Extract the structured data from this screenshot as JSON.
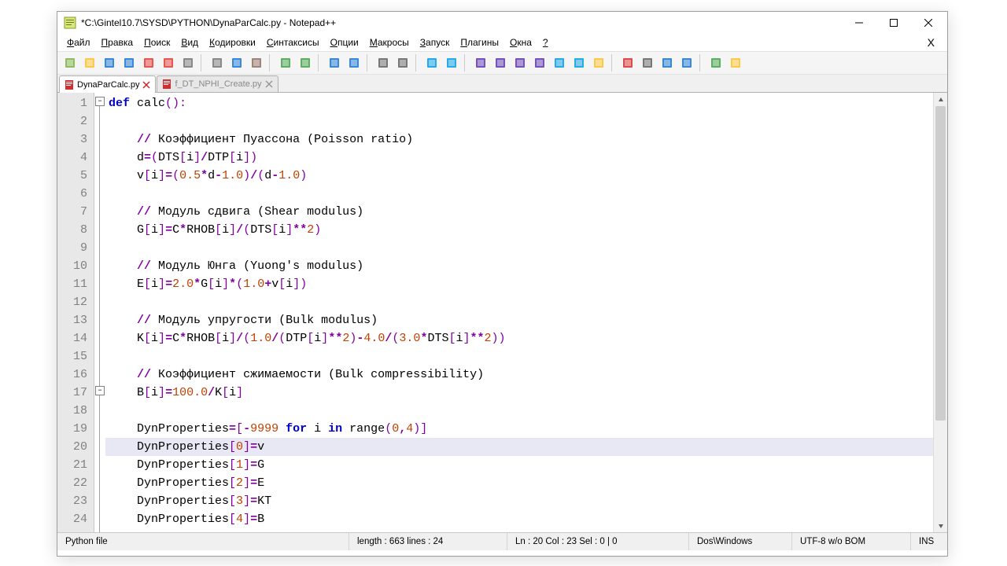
{
  "window": {
    "title": "*C:\\Gintel10.7\\SYSD\\PYTHON\\DynaParCalc.py - Notepad++"
  },
  "menu": {
    "file": "Файл",
    "edit": "Правка",
    "search": "Поиск",
    "view": "Вид",
    "encoding": "Кодировки",
    "syntax": "Синтаксисы",
    "options": "Опции",
    "macros": "Макросы",
    "run": "Запуск",
    "plugins": "Плагины",
    "windows": "Окна",
    "help": "?"
  },
  "tabs": [
    {
      "label": "DynaParCalc.py",
      "active": true,
      "dirty": true
    },
    {
      "label": "f_DT_NPHI_Create.py",
      "active": false,
      "dirty": true
    }
  ],
  "code": {
    "lines": [
      {
        "n": 1,
        "html": "<span class='kw'>def</span> <span class='fn'>calc</span><span class='br'>():</span>"
      },
      {
        "n": 2,
        "html": ""
      },
      {
        "n": 3,
        "html": "    <span class='op'>//</span> <span class='cm'>Коэффициент Пуассона (Poisson ratio)</span>"
      },
      {
        "n": 4,
        "html": "    d<span class='op'>=</span><span class='br'>(</span>DTS<span class='br'>[</span>i<span class='br'>]</span><span class='op'>/</span>DTP<span class='br'>[</span>i<span class='br'>])</span>"
      },
      {
        "n": 5,
        "html": "    v<span class='br'>[</span>i<span class='br'>]</span><span class='op'>=</span><span class='br'>(</span><span class='num'>0.5</span><span class='op'>*</span>d<span class='op'>-</span><span class='num'>1.0</span><span class='br'>)</span><span class='op'>/</span><span class='br'>(</span>d<span class='op'>-</span><span class='num'>1.0</span><span class='br'>)</span>"
      },
      {
        "n": 6,
        "html": ""
      },
      {
        "n": 7,
        "html": "    <span class='op'>//</span> <span class='cm'>Модуль сдвига (Shear modulus)</span>"
      },
      {
        "n": 8,
        "html": "    G<span class='br'>[</span>i<span class='br'>]</span><span class='op'>=</span>C<span class='op'>*</span>RHOB<span class='br'>[</span>i<span class='br'>]</span><span class='op'>/</span><span class='br'>(</span>DTS<span class='br'>[</span>i<span class='br'>]</span><span class='op'>**</span><span class='num'>2</span><span class='br'>)</span>"
      },
      {
        "n": 9,
        "html": ""
      },
      {
        "n": 10,
        "html": "    <span class='op'>//</span> <span class='cm'>Модуль Юнга (Yuong's modulus)</span>"
      },
      {
        "n": 11,
        "html": "    E<span class='br'>[</span>i<span class='br'>]</span><span class='op'>=</span><span class='num'>2.0</span><span class='op'>*</span>G<span class='br'>[</span>i<span class='br'>]</span><span class='op'>*</span><span class='br'>(</span><span class='num'>1.0</span><span class='op'>+</span>v<span class='br'>[</span>i<span class='br'>])</span>"
      },
      {
        "n": 12,
        "html": ""
      },
      {
        "n": 13,
        "html": "    <span class='op'>//</span> <span class='cm'>Модуль упругости (Bulk modulus)</span>"
      },
      {
        "n": 14,
        "html": "    K<span class='br'>[</span>i<span class='br'>]</span><span class='op'>=</span>C<span class='op'>*</span>RHOB<span class='br'>[</span>i<span class='br'>]</span><span class='op'>/</span><span class='br'>(</span><span class='num'>1.0</span><span class='op'>/</span><span class='br'>(</span>DTP<span class='br'>[</span>i<span class='br'>]</span><span class='op'>**</span><span class='num'>2</span><span class='br'>)</span><span class='op'>-</span><span class='num'>4.0</span><span class='op'>/</span><span class='br'>(</span><span class='num'>3.0</span><span class='op'>*</span>DTS<span class='br'>[</span>i<span class='br'>]</span><span class='op'>**</span><span class='num'>2</span><span class='br'>))</span>"
      },
      {
        "n": 15,
        "html": ""
      },
      {
        "n": 16,
        "html": "    <span class='op'>//</span> <span class='cm'>Коэффициент сжимаемости (Bulk compressibility)</span>"
      },
      {
        "n": 17,
        "html": "    B<span class='br'>[</span>i<span class='br'>]</span><span class='op'>=</span><span class='num'>100.0</span><span class='op'>/</span>K<span class='br'>[</span>i<span class='br'>]</span>"
      },
      {
        "n": 18,
        "html": ""
      },
      {
        "n": 19,
        "html": "    DynProperties<span class='op'>=</span><span class='br'>[</span><span class='op'>-</span><span class='num'>9999</span> <span class='kw'>for</span> i <span class='kw'>in</span> <span class='fn'>range</span><span class='br'>(</span><span class='num'>0</span><span class='op'>,</span><span class='num'>4</span><span class='br'>)]</span>"
      },
      {
        "n": 20,
        "html": "    DynProperties<span class='br'>[</span><span class='num'>0</span><span class='br'>]</span><span class='op'>=</span>v",
        "hl": true
      },
      {
        "n": 21,
        "html": "    DynProperties<span class='br'>[</span><span class='num'>1</span><span class='br'>]</span><span class='op'>=</span>G"
      },
      {
        "n": 22,
        "html": "    DynProperties<span class='br'>[</span><span class='num'>2</span><span class='br'>]</span><span class='op'>=</span>E"
      },
      {
        "n": 23,
        "html": "    DynProperties<span class='br'>[</span><span class='num'>3</span><span class='br'>]</span><span class='op'>=</span>KT"
      },
      {
        "n": 24,
        "html": "    DynProperties<span class='br'>[</span><span class='num'>4</span><span class='br'>]</span><span class='op'>=</span>B"
      }
    ]
  },
  "status": {
    "filetype": "Python file",
    "length": "length : 663    lines : 24",
    "pos": "Ln : 20    Col : 23    Sel : 0 | 0",
    "eol": "Dos\\Windows",
    "encoding": "UTF-8 w/o BOM",
    "mode": "INS"
  },
  "toolbar_icons": [
    "new",
    "open",
    "save",
    "save-all",
    "close",
    "close-all",
    "print",
    "sep",
    "cut",
    "copy",
    "paste",
    "sep",
    "undo",
    "redo",
    "sep",
    "find",
    "replace",
    "sep",
    "zoom-in",
    "zoom-out",
    "sep",
    "sync-v",
    "sync-h",
    "sep",
    "wordwrap",
    "allchars",
    "indent-guide",
    "udl",
    "doc-map",
    "func-list",
    "folder",
    "sep",
    "macro-rec",
    "macro-stop",
    "macro-play",
    "macro-play-multi",
    "sep",
    "spellcheck",
    "spell-next"
  ]
}
